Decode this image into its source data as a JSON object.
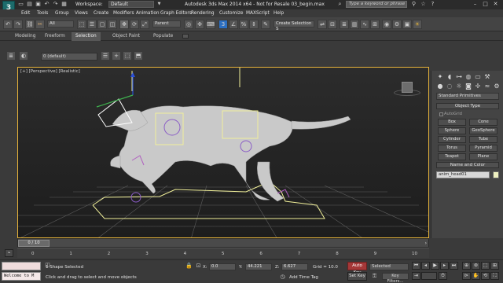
{
  "titlebar": {
    "logo_text": "3",
    "workspace_label": "Workspace:",
    "workspace_value": "Default",
    "title": "Autodesk 3ds Max  2014 x64  -  Not for Resale   03_begin.max",
    "search_placeholder": "Type a keyword or phrase"
  },
  "menu": {
    "items": [
      "Edit",
      "Tools",
      "Group",
      "Views",
      "Create",
      "Modifiers",
      "Animation",
      "Graph Editors",
      "Rendering",
      "Customize",
      "MAXScript",
      "Help"
    ]
  },
  "toolbar": {
    "selection_filter": "All",
    "reference_coord": "Parent",
    "named_selection": "Create Selection S"
  },
  "ribbon": {
    "tabs": [
      "Modeling",
      "Freeform",
      "Selection",
      "Object Paint",
      "Populate"
    ],
    "active_tab": "Selection"
  },
  "layers": {
    "current_layer": "0 (default)"
  },
  "viewport": {
    "label": "[+] [Perspective] [Realistic]",
    "accent": "#e7b43a"
  },
  "command_panel": {
    "category": "Standard Primitives",
    "object_type_title": "Object Type",
    "autogrid_label": "AutoGrid",
    "buttons": [
      "Box",
      "Cone",
      "Sphere",
      "GeoSphere",
      "Cylinder",
      "Tube",
      "Torus",
      "Pyramid",
      "Teapot",
      "Plane"
    ],
    "name_color_title": "Name and Color",
    "object_name": "anim_head01",
    "object_color": "#eef0c0"
  },
  "timeline": {
    "frame_display": "0 / 10",
    "ticks": [
      "0",
      "1",
      "2",
      "3",
      "4",
      "5",
      "6",
      "7",
      "8",
      "9",
      "10"
    ],
    "current_frame_fraction": 0.0
  },
  "status": {
    "maxscript_text": "Welcome to M",
    "selection_text": "1 Shape Selected",
    "prompt_text": "Click and drag to select and move objects",
    "x_label": "X:",
    "x_value": "0.0",
    "y_label": "Y:",
    "y_value": "44.221",
    "z_label": "Z:",
    "z_value": "6.627",
    "grid_text": "Grid = 10.0",
    "add_time_tag": "Add Time Tag",
    "auto_key": "Auto Key",
    "set_key": "Set Key",
    "key_set": "Selected",
    "key_filters": "Key Filters...",
    "autokey_color": "#a53838"
  }
}
